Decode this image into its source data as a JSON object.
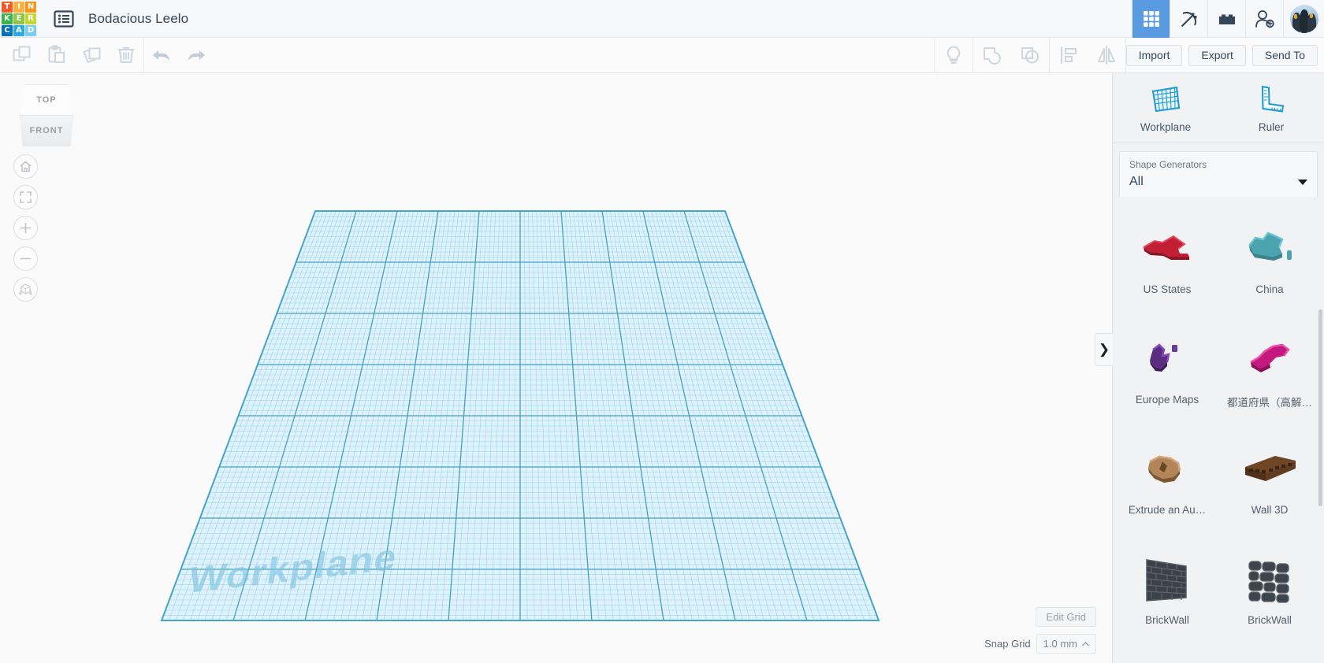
{
  "app": {
    "logo_letters": [
      {
        "ch": "T",
        "color": "#f05a28"
      },
      {
        "ch": "I",
        "color": "#fbb040"
      },
      {
        "ch": "N",
        "color": "#f7941e"
      },
      {
        "ch": "K",
        "color": "#39b54a"
      },
      {
        "ch": "E",
        "color": "#8dc63f"
      },
      {
        "ch": "R",
        "color": "#c4d82e"
      },
      {
        "ch": "C",
        "color": "#0071bc"
      },
      {
        "ch": "A",
        "color": "#29abe2"
      },
      {
        "ch": "D",
        "color": "#7accf0"
      }
    ],
    "document_title": "Bodacious Leelo"
  },
  "header": {
    "tools": [
      {
        "name": "grid-3d-view-icon",
        "label": "3D Design",
        "active": true
      },
      {
        "name": "pickaxe-icon",
        "label": "Blocks",
        "active": false
      },
      {
        "name": "brick-icon",
        "label": "Bricks",
        "active": false
      },
      {
        "name": "add-user-icon",
        "label": "Invite",
        "active": false
      }
    ],
    "avatar_alt": "penguins-avatar"
  },
  "toolbar": {
    "left_tools": [
      {
        "name": "copy-icon",
        "label": "Copy"
      },
      {
        "name": "paste-icon",
        "label": "Paste"
      },
      {
        "name": "duplicate-icon",
        "label": "Duplicate"
      },
      {
        "name": "trash-icon",
        "label": "Delete"
      }
    ],
    "history_tools": [
      {
        "name": "undo-icon",
        "label": "Undo"
      },
      {
        "name": "redo-icon",
        "label": "Redo"
      }
    ],
    "right_tools": [
      {
        "name": "lightbulb-icon",
        "label": "Hints"
      },
      {
        "name": "group-icon",
        "label": "Group"
      },
      {
        "name": "ungroup-icon",
        "label": "Ungroup"
      },
      {
        "name": "align-icon",
        "label": "Align"
      },
      {
        "name": "mirror-icon",
        "label": "Mirror"
      }
    ],
    "import_label": "Import",
    "export_label": "Export",
    "send_to_label": "Send To"
  },
  "canvas": {
    "viewcube": {
      "top_label": "TOP",
      "front_label": "FRONT"
    },
    "nav_buttons": [
      {
        "name": "home-view-icon",
        "label": "Home view"
      },
      {
        "name": "fit-to-view-icon",
        "label": "Fit all in view"
      },
      {
        "name": "zoom-in-icon",
        "label": "Zoom in"
      },
      {
        "name": "zoom-out-icon",
        "label": "Zoom out"
      },
      {
        "name": "perspective-toggle-icon",
        "label": "Switch to orthographic/perspective view"
      }
    ],
    "workplane_label": "Workplane",
    "edit_grid_label": "Edit Grid",
    "snap_grid_label": "Snap Grid",
    "snap_grid_value": "1.0 mm",
    "grid_color": "#5bb7dd",
    "grid_fill": "#d6f0fa"
  },
  "right_panel": {
    "top_tiles": [
      {
        "name": "workplane-tool",
        "label": "Workplane"
      },
      {
        "name": "ruler-tool",
        "label": "Ruler"
      }
    ],
    "generators_title": "Shape Generators",
    "generators_value": "All",
    "collapse_icon": "❯",
    "shapes": [
      {
        "name": "US States",
        "thumb": "us-states"
      },
      {
        "name": "China",
        "thumb": "china"
      },
      {
        "name": "Europe Maps",
        "thumb": "europe-maps"
      },
      {
        "name": "都道府県（高解…",
        "thumb": "japan-prefectures"
      },
      {
        "name": "Extrude an Au…",
        "thumb": "australia"
      },
      {
        "name": "Wall 3D",
        "thumb": "wall-3d"
      },
      {
        "name": "BrickWall",
        "thumb": "brickwall-flat"
      },
      {
        "name": "BrickWall",
        "thumb": "brickwall-stone"
      }
    ]
  }
}
